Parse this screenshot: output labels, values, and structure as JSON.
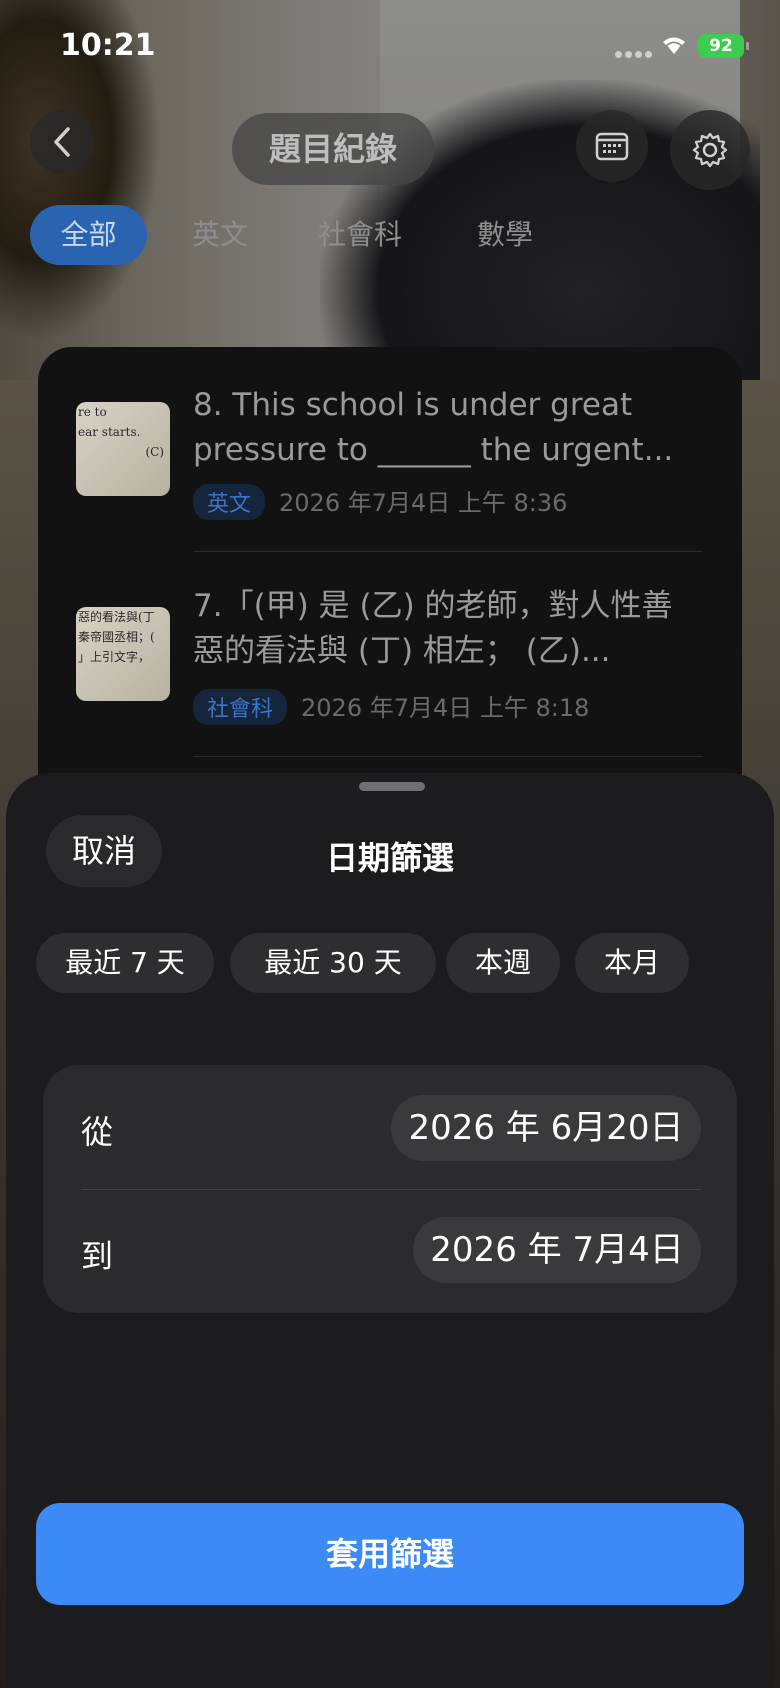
{
  "status_bar": {
    "time": "10:21",
    "battery": "92"
  },
  "nav": {
    "title": "題目紀錄"
  },
  "tabs": [
    {
      "label": "全部",
      "active": true
    },
    {
      "label": "英文",
      "active": false
    },
    {
      "label": "社會科",
      "active": false
    },
    {
      "label": "數學",
      "active": false
    }
  ],
  "questions": [
    {
      "thumb_lines": [
        "re to",
        "ear starts.",
        "(C)"
      ],
      "text": "8. This school is under great pressure to ______ the urgent...",
      "subject": "英文",
      "timestamp": "2026 年7月4日 上午 8:36"
    },
    {
      "thumb_lines": [
        "惡的看法與(丁",
        "秦帝國丞相；(",
        "」上引文字，"
      ],
      "text": "7.「(甲) 是 (乙) 的老師，對人性善惡的看法與 (丁) 相左； (乙)...",
      "subject": "社會科",
      "timestamp": "2026 年7月4日 上午 8:18"
    }
  ],
  "sheet": {
    "cancel_label": "取消",
    "title": "日期篩選",
    "presets": [
      "最近 7 天",
      "最近 30 天",
      "本週",
      "本月"
    ],
    "from_label": "從",
    "from_date": "2026 年 6月20日",
    "to_label": "到",
    "to_date": "2026 年 7月4日",
    "apply_label": "套用篩選"
  },
  "colors": {
    "accent": "#3c8af5",
    "active_tab": "#2a64b0",
    "battery": "#3ccc50"
  }
}
